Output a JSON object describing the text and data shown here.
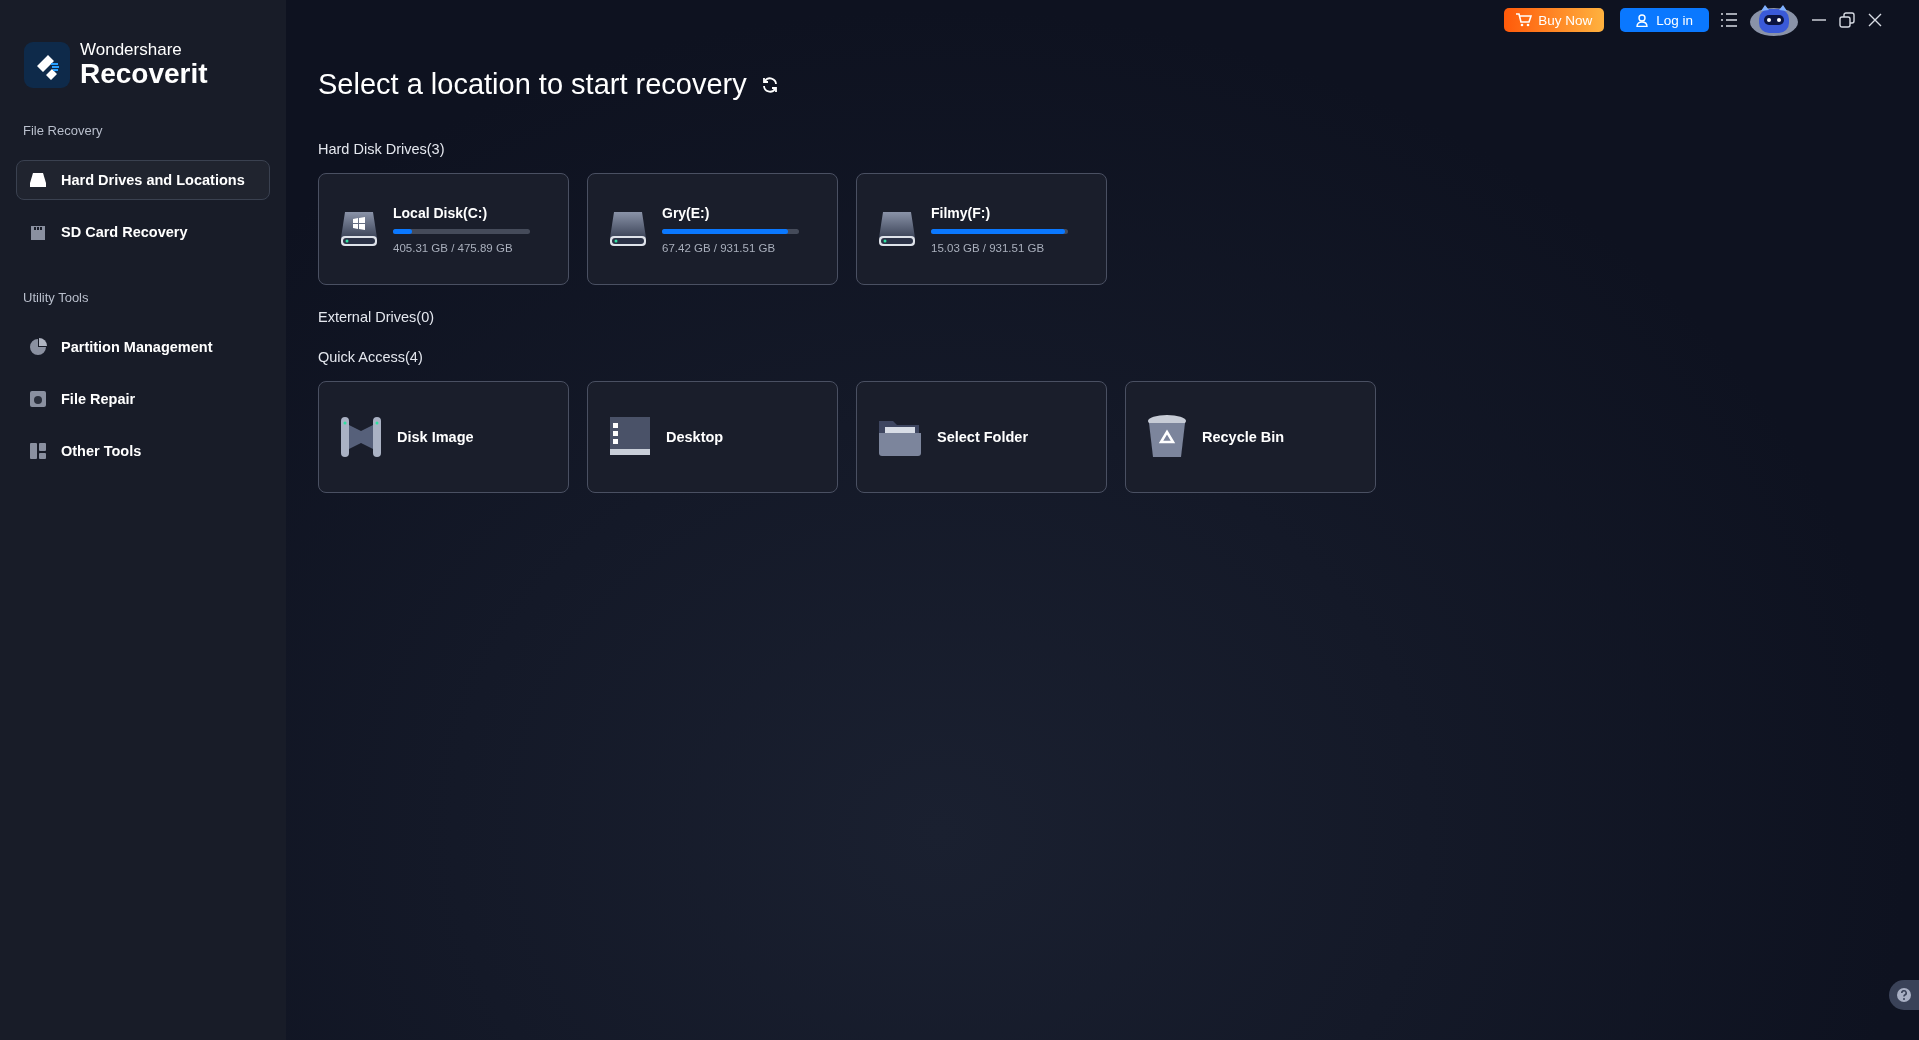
{
  "brand": {
    "company": "Wondershare",
    "product": "Recoverit"
  },
  "sidebar": {
    "sections": [
      {
        "title": "File Recovery",
        "items": [
          {
            "label": "Hard Drives and Locations",
            "kind": "drive",
            "selected": true
          },
          {
            "label": "SD Card Recovery",
            "kind": "sdcard",
            "selected": false
          }
        ]
      },
      {
        "title": "Utility Tools",
        "items": [
          {
            "label": "Partition Management",
            "kind": "pie",
            "selected": false
          },
          {
            "label": "File Repair",
            "kind": "repair",
            "selected": false
          },
          {
            "label": "Other Tools",
            "kind": "tools",
            "selected": false
          }
        ]
      }
    ]
  },
  "top_bar": {
    "buy_button": "Buy Now",
    "login_button": "Log in"
  },
  "title": "Select a location to start recovery",
  "hard_disk_drives": {
    "heading": "Hard Disk Drives(3)",
    "drives": [
      {
        "name": "Local Disk(C:)",
        "usage": "405.31 GB / 475.89 GB",
        "level": 0.14,
        "kind": "system"
      },
      {
        "name": "Gry(E:)",
        "usage": "67.42 GB / 931.51 GB",
        "level": 0.92,
        "kind": "data"
      },
      {
        "name": "Filmy(F:)",
        "usage": "15.03 GB / 931.51 GB",
        "level": 0.98,
        "kind": "data"
      }
    ]
  },
  "external_drives": {
    "heading": "External Drives(0)"
  },
  "quick_access": {
    "heading": "Quick Access(4)",
    "items": [
      {
        "label": "Disk Image",
        "kind": "diskimage"
      },
      {
        "label": "Desktop",
        "kind": "desktop"
      },
      {
        "label": "Select Folder",
        "kind": "folder"
      },
      {
        "label": "Recycle Bin",
        "kind": "bin"
      }
    ]
  }
}
